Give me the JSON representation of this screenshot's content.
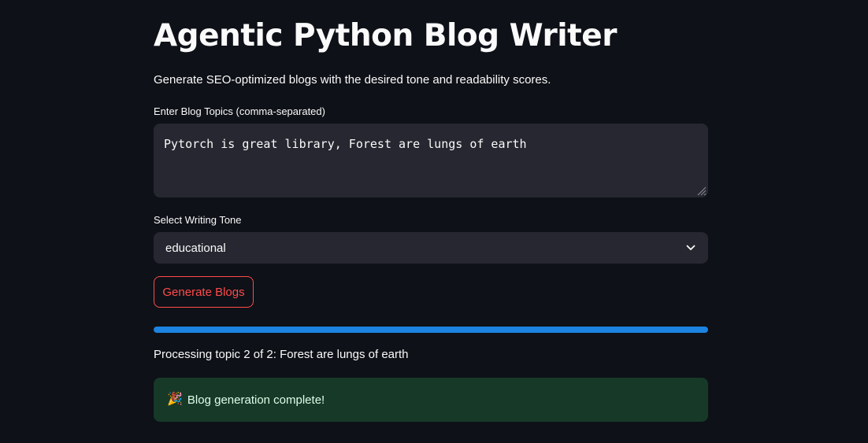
{
  "page": {
    "title": "Agentic Python Blog Writer",
    "subtitle": "Generate SEO-optimized blogs with the desired tone and readability scores."
  },
  "form": {
    "topics_label": "Enter Blog Topics (comma-separated)",
    "topics_value": "Pytorch is great library, Forest are lungs of earth",
    "tone_label": "Select Writing Tone",
    "tone_selected": "educational",
    "submit_label": "Generate Blogs"
  },
  "progress": {
    "fraction": 1.0,
    "status_text": "Processing topic 2 of 2: Forest are lungs of earth"
  },
  "alert": {
    "icon": "party-popper-icon",
    "message": "Blog generation complete!"
  },
  "colors": {
    "background": "#0e1117",
    "surface": "#262730",
    "accent": "#ff4b4b",
    "progress": "#1c83e1",
    "success_bg": "#173928"
  }
}
